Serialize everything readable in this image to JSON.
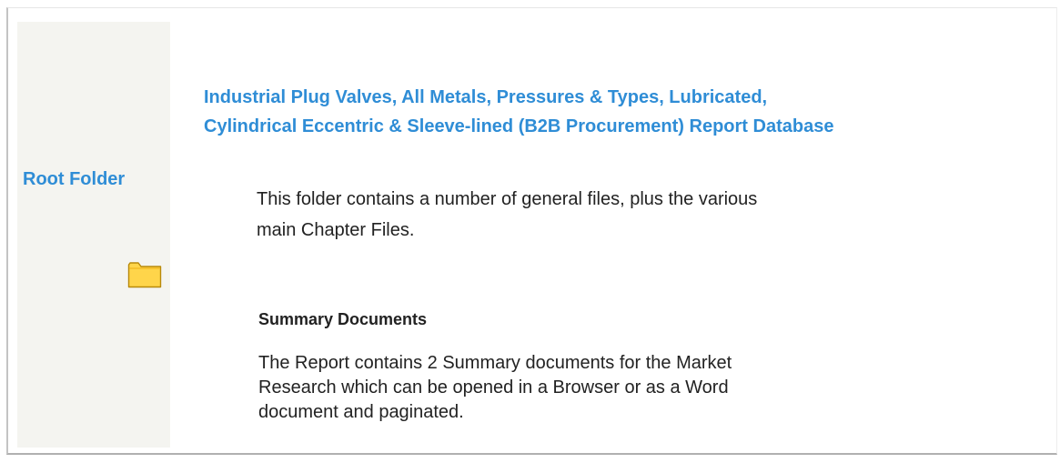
{
  "sidebar": {
    "title": "Root Folder",
    "icon": "folder-icon",
    "folder_color": "#ffd54a"
  },
  "main": {
    "title_lines": [
      "Industrial Plug Valves, All Metals, Pressures & Types, Lubricated,",
      "Cylindrical Eccentric & Sleeve-lined (B2B Procurement) Report Database"
    ],
    "intro_lines": [
      "This folder contains a number of general files, plus the various",
      "main Chapter Files."
    ],
    "section": {
      "heading": "Summary Documents",
      "body_lines": [
        "The Report contains 2 Summary documents for the Market",
        "Research which can be opened in a Browser or as a Word",
        "document and paginated."
      ]
    }
  },
  "colors": {
    "accent": "#2f8dd6",
    "text": "#222222",
    "sidebar_bg": "#f4f4f0"
  }
}
